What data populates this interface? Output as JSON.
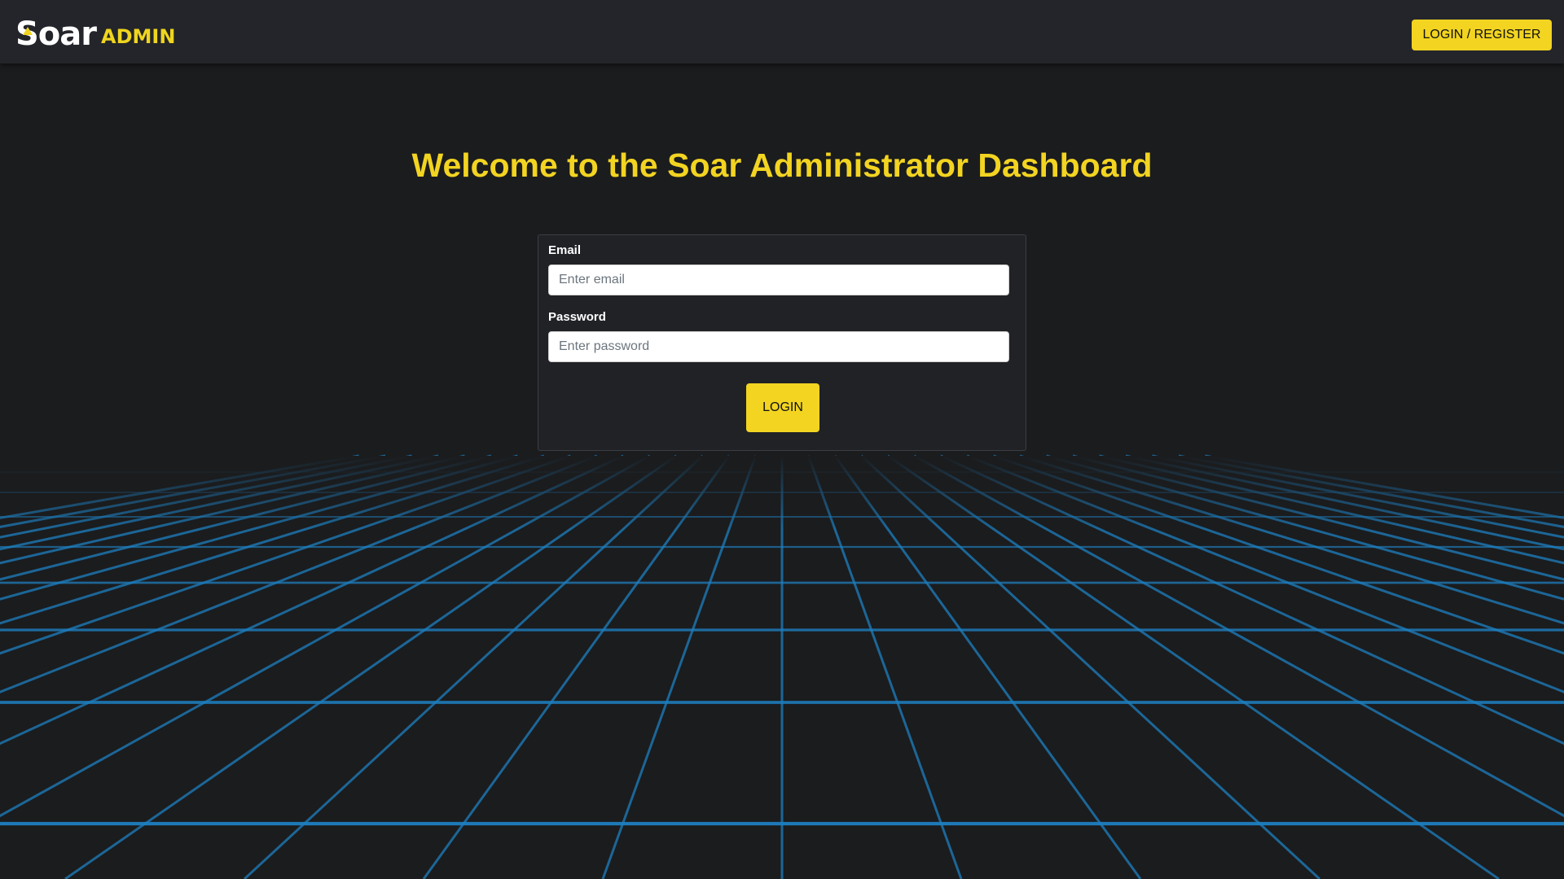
{
  "brand": {
    "wordmark": "Soar",
    "sub": "ADMIN",
    "accent_color": "#f2d421"
  },
  "nav": {
    "login_register_label": "LOGIN / REGISTER"
  },
  "main": {
    "title": "Welcome to the Soar Administrator Dashboard"
  },
  "login_form": {
    "email": {
      "label": "Email",
      "placeholder": "Enter email",
      "value": ""
    },
    "password": {
      "label": "Password",
      "placeholder": "Enter password",
      "value": ""
    },
    "submit_label": "LOGIN"
  },
  "background": {
    "grid_color": "#1e7fc0"
  }
}
